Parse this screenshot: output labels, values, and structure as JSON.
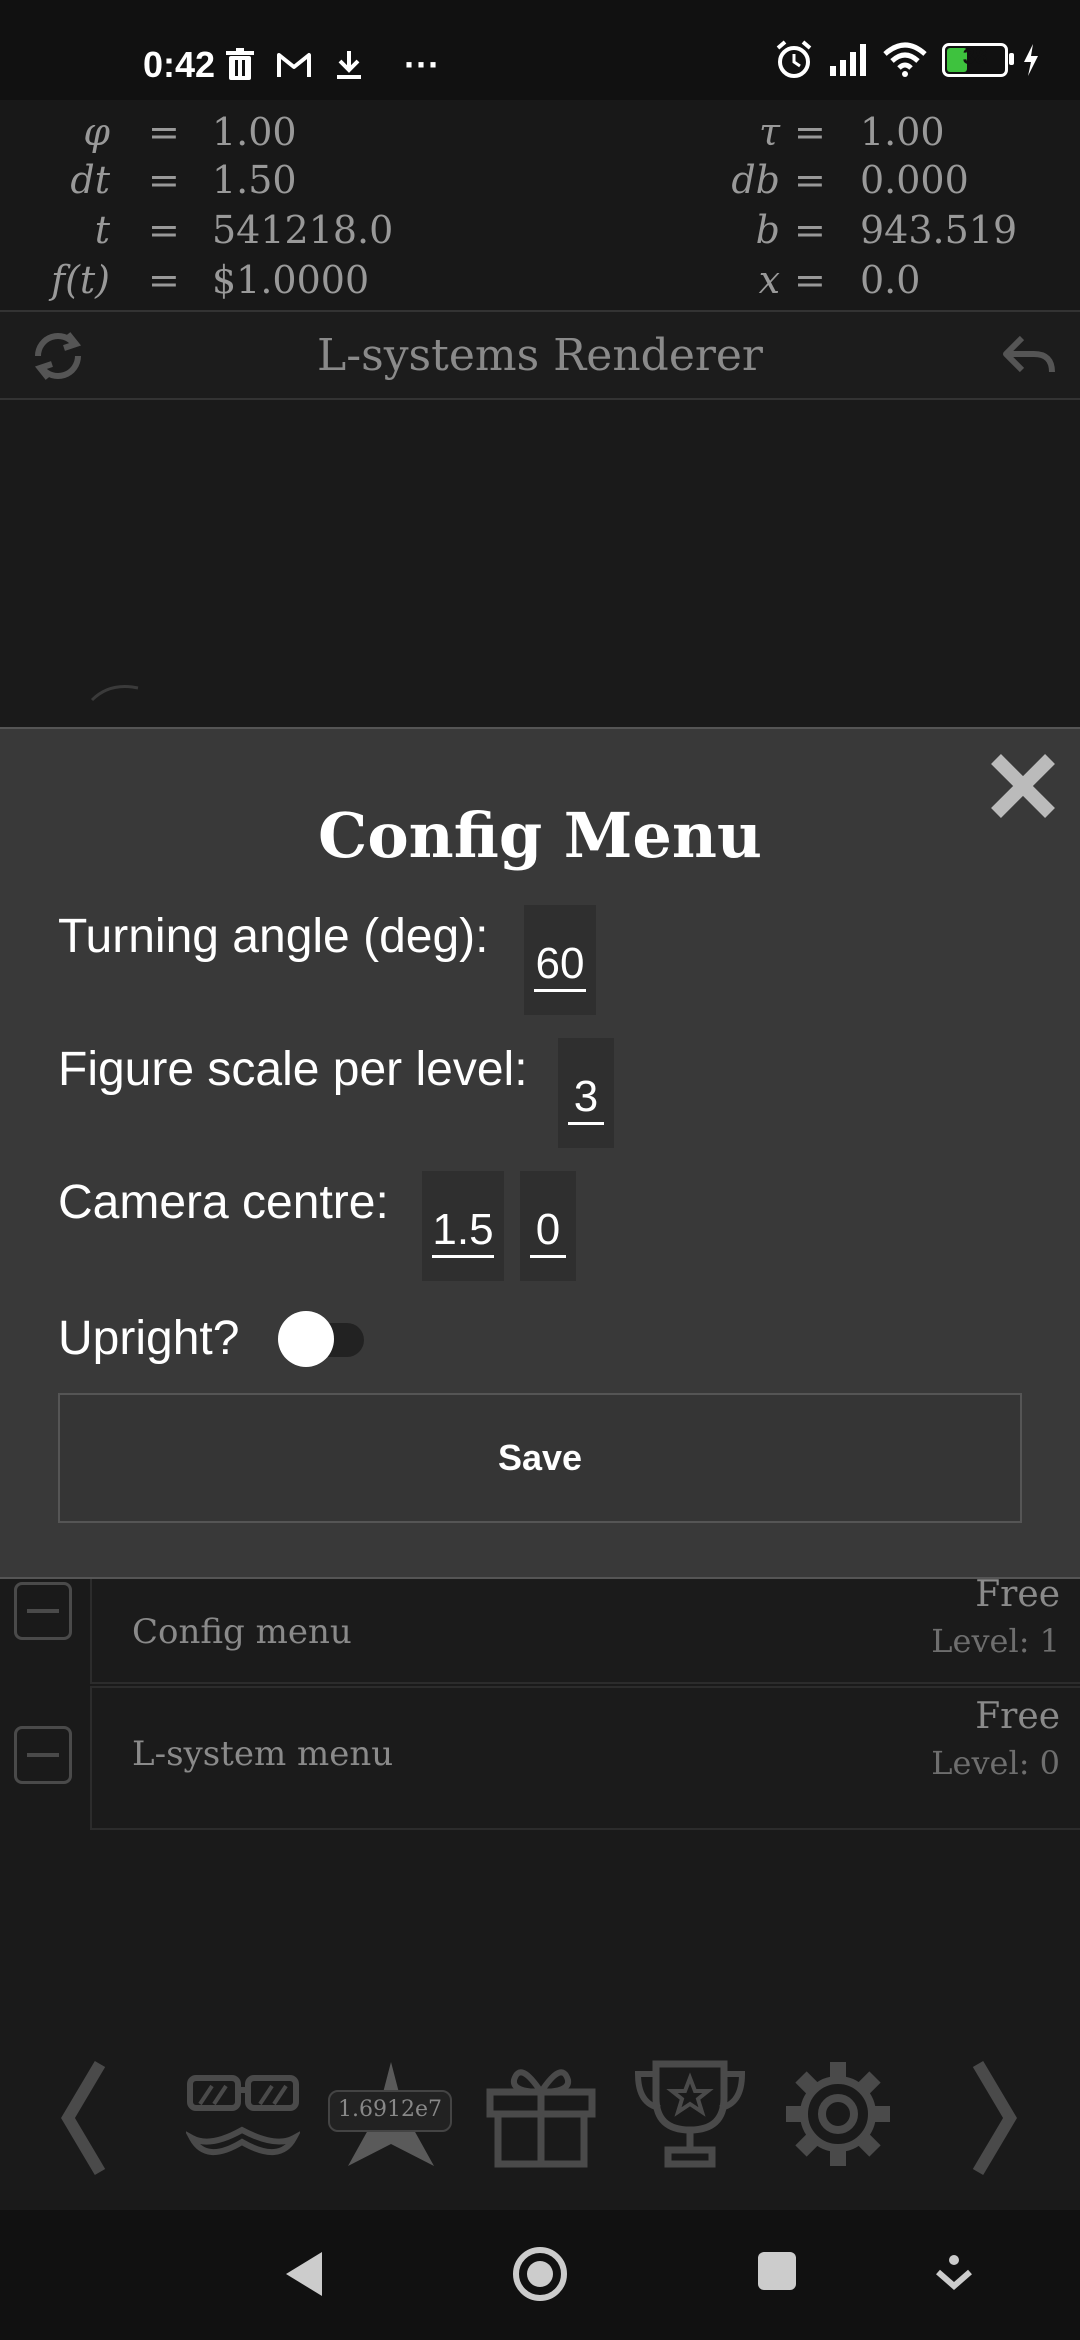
{
  "status_bar": {
    "time": "0:42",
    "battery_level": "38",
    "icons": [
      "trash-icon",
      "gmail-icon",
      "download-icon",
      "more-icon",
      "alarm-icon",
      "signal-icon",
      "wifi-icon",
      "battery-icon",
      "charging-icon"
    ],
    "more": "···"
  },
  "equations": {
    "left": [
      {
        "lhs": "φ",
        "op": "=",
        "rhs": "1.00"
      },
      {
        "lhs": "dt",
        "op": "=",
        "rhs": "1.50"
      },
      {
        "lhs": "t",
        "op": "=",
        "rhs": "541218.0"
      },
      {
        "lhs": "f(t)",
        "op": "=",
        "rhs": "$1.0000"
      }
    ],
    "right": [
      {
        "lhs": "τ",
        "op": "=",
        "rhs": "1.00"
      },
      {
        "lhs": "db",
        "op": "=",
        "rhs": "0.000"
      },
      {
        "lhs": "b",
        "op": "=",
        "rhs": "943.519"
      },
      {
        "lhs": "x",
        "op": "=",
        "rhs": "0.0"
      }
    ]
  },
  "header": {
    "title": "L-systems Renderer"
  },
  "modal": {
    "title": "Config Menu",
    "turning_angle_label": "Turning angle (deg):",
    "turning_angle_value": "60",
    "scale_label": "Figure scale per level:",
    "scale_value": "3",
    "camera_label": "Camera centre:",
    "camera_x": "1.5",
    "camera_y": "0",
    "upright_label": "Upright?",
    "upright_on": false,
    "save_label": "Save"
  },
  "menu_rows": [
    {
      "label": "Config menu",
      "price": "Free",
      "level": "Level: 1"
    },
    {
      "label": "L-system menu",
      "price": "Free",
      "level": "Level: 0"
    }
  ],
  "bottom_bar": {
    "score": "1.6912e7",
    "icons": [
      "chevron-left-icon",
      "glasses-mustache-icon",
      "star-icon",
      "gift-icon",
      "trophy-icon",
      "gear-icon",
      "chevron-right-icon"
    ]
  },
  "colors": {
    "background": "#1a1a1a",
    "modal": "#393939",
    "battery": "#3ec23e"
  }
}
